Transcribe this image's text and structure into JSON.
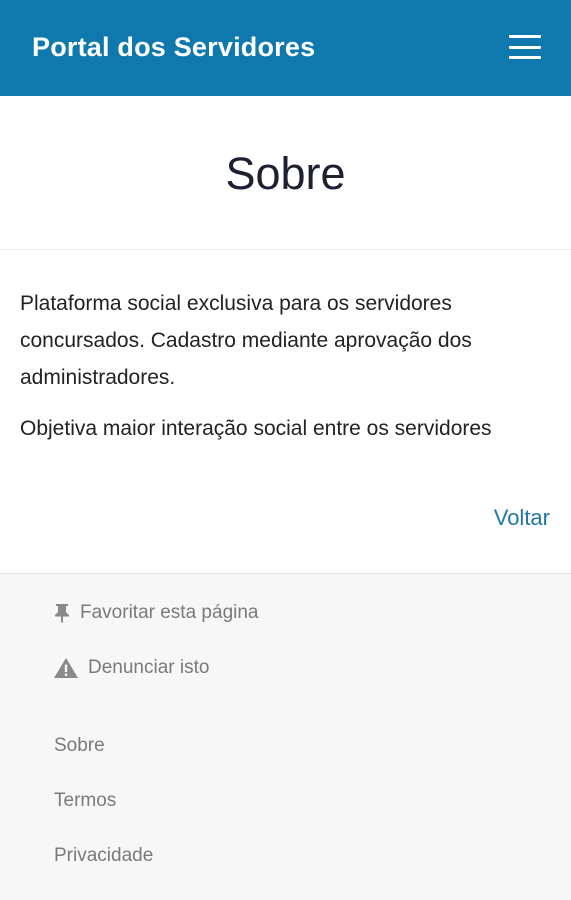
{
  "header": {
    "app_title": "Portal dos Servidores"
  },
  "page": {
    "title": "Sobre",
    "paragraphs": [
      "Plataforma social exclusiva para os servidores concursados. Cadastro mediante aprovação dos administradores.",
      "Objetiva maior interação social entre os servidores"
    ],
    "back_label": "Voltar"
  },
  "footer": {
    "favorite_label": "Favoritar esta página",
    "report_label": "Denunciar isto",
    "links": [
      "Sobre",
      "Termos",
      "Privacidade"
    ]
  },
  "colors": {
    "topbar": "#0f79ad",
    "link": "#1b77a8",
    "footer_bg": "#f7f7f7"
  }
}
